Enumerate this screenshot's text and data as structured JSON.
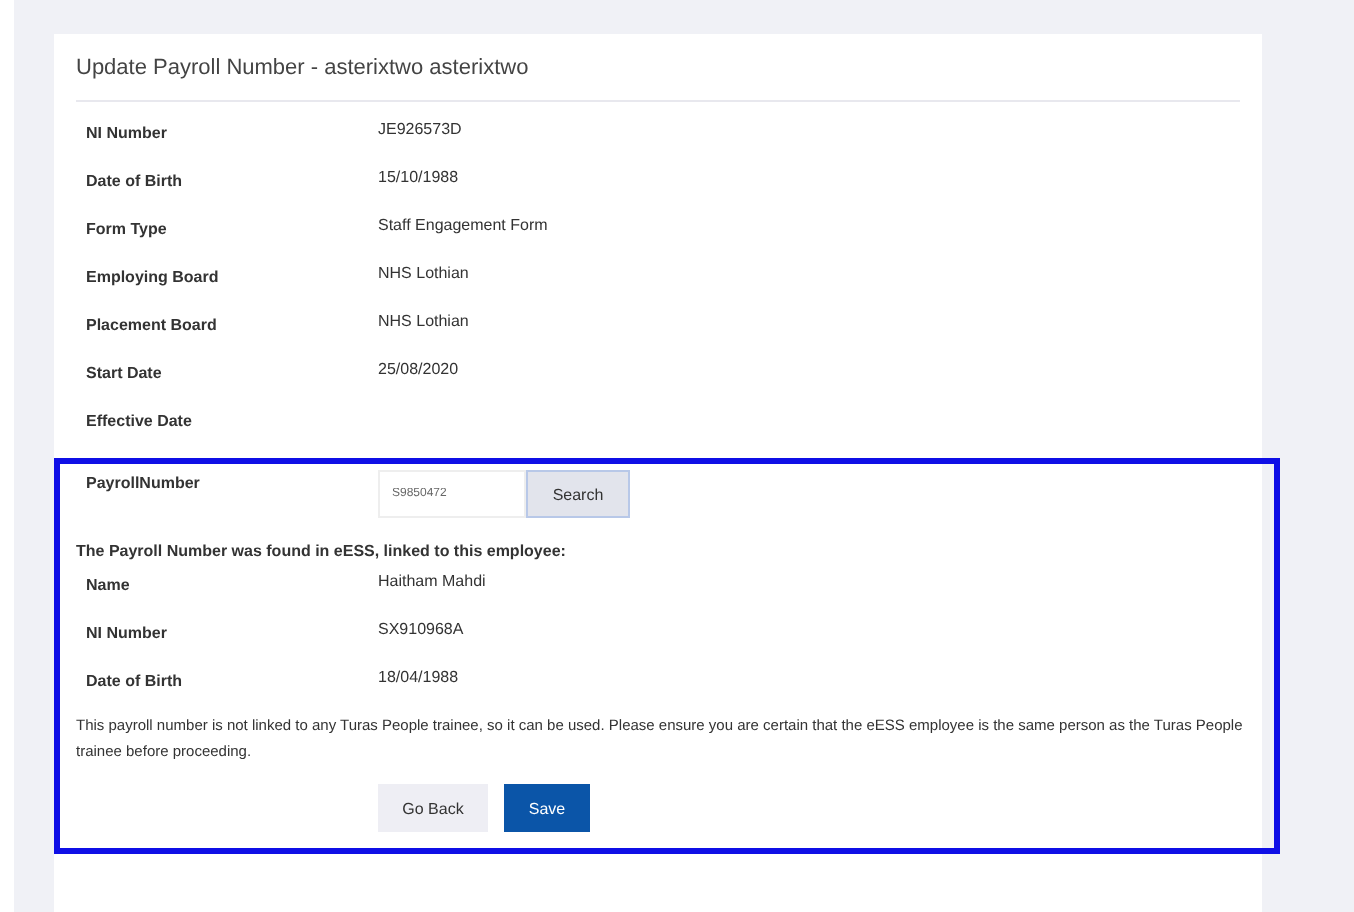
{
  "title": "Update Payroll Number - asterixtwo asterixtwo",
  "details": [
    {
      "label": "NI Number",
      "value": "JE926573D"
    },
    {
      "label": "Date of Birth",
      "value": "15/10/1988"
    },
    {
      "label": "Form Type",
      "value": "Staff Engagement Form"
    },
    {
      "label": "Employing Board",
      "value": "NHS Lothian"
    },
    {
      "label": "Placement Board",
      "value": "NHS Lothian"
    },
    {
      "label": "Start Date",
      "value": "25/08/2020"
    },
    {
      "label": "Effective Date"
    }
  ],
  "payroll": {
    "label": "PayrollNumber",
    "value": "S9850472",
    "search_button": "Search"
  },
  "found_message": "The Payroll Number was found in eESS, linked to this employee:",
  "employee": [
    {
      "label": "Name",
      "value": "Haitham Mahdi"
    },
    {
      "label": "NI Number",
      "value": "SX910968A"
    },
    {
      "label": "Date of Birth",
      "value": "18/04/1988"
    }
  ],
  "notice": "This payroll number is not linked to any Turas People trainee, so it can be used. Please ensure you are certain that the eESS employee is the same person as the Turas People trainee before proceeding.",
  "buttons": {
    "back": "Go Back",
    "save": "Save"
  }
}
